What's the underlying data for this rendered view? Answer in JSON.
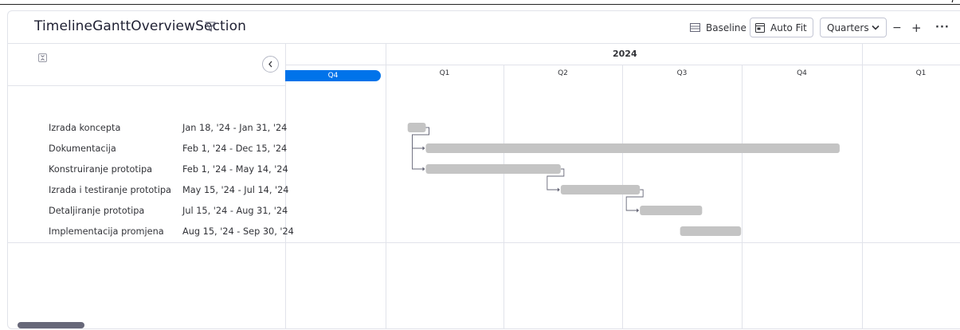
{
  "page": {
    "corner_mark": "p"
  },
  "header": {
    "title": "TimelineGanttOverviewSection",
    "baseline_label": "Baseline",
    "autofit_label": "Auto Fit",
    "zoom_select_value": "Quarters",
    "zoom_out_label": "−",
    "zoom_in_label": "+",
    "more_label": "···"
  },
  "timeline": {
    "year": "2024",
    "quarters": [
      "Q4",
      "Q1",
      "Q2",
      "Q3",
      "Q4",
      "Q1"
    ],
    "current_quarter_index": 0
  },
  "tasks": [
    {
      "name": "Izrada koncepta",
      "dates": "Jan 18, '24 - Jan 31, '24",
      "start": "2024-01-18",
      "end": "2024-01-31"
    },
    {
      "name": "Dokumentacija",
      "dates": "Feb 1, '24 - Dec 15, '24",
      "start": "2024-02-01",
      "end": "2024-12-15"
    },
    {
      "name": "Konstruiranje prototipa",
      "dates": "Feb 1, '24 - May 14, '24",
      "start": "2024-02-01",
      "end": "2024-05-14"
    },
    {
      "name": "Izrada i testiranje prototipa",
      "dates": "May 15, '24 - Jul 14, '24",
      "start": "2024-05-15",
      "end": "2024-07-14"
    },
    {
      "name": "Detaljiranje prototipa",
      "dates": "Jul 15, '24 - Aug 31, '24",
      "start": "2024-07-15",
      "end": "2024-08-31"
    },
    {
      "name": "Implementacija promjena",
      "dates": "Aug 15, '24 - Sep 30, '24",
      "start": "2024-08-15",
      "end": "2024-09-30"
    }
  ],
  "dependencies": [
    {
      "from": 0,
      "to": 1
    },
    {
      "from": 0,
      "to": 2
    },
    {
      "from": 2,
      "to": 3
    },
    {
      "from": 3,
      "to": 4
    }
  ],
  "colors": {
    "bar": "#c4c4c4",
    "current_quarter": "#0073ea",
    "grid": "#e1e3ea",
    "connector": "#676879"
  }
}
